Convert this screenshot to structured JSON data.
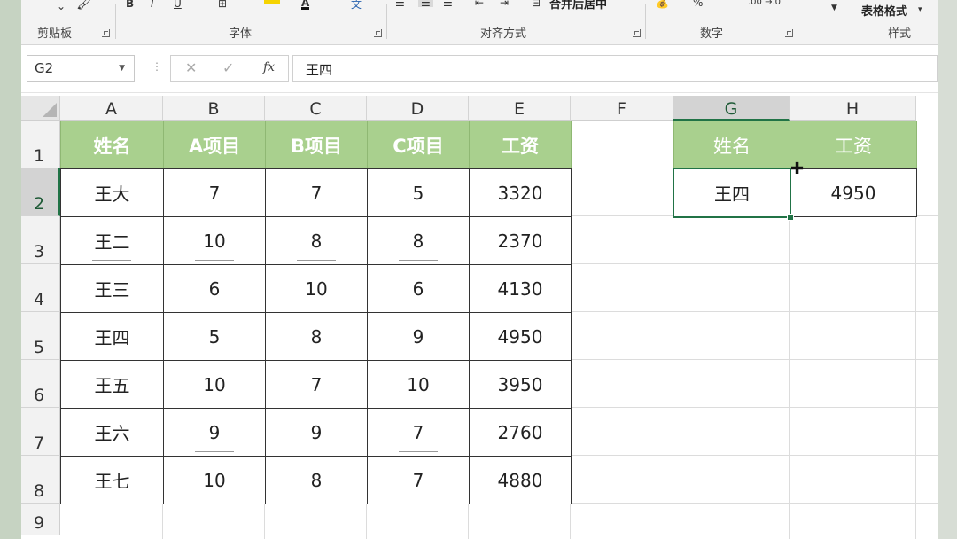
{
  "ribbon": {
    "groups": [
      {
        "label": "剪贴板"
      },
      {
        "label": "字体"
      },
      {
        "label": "对齐方式"
      },
      {
        "label": "数字"
      },
      {
        "label": "样式"
      }
    ],
    "merge_center_label": "合并后居中",
    "table_format_label": "表格格式",
    "bold_glyph": "B",
    "italic_glyph": "I",
    "underline_glyph": "U",
    "percent_glyph": "%"
  },
  "formula_bar": {
    "name_box": "G2",
    "cancel_glyph": "✕",
    "enter_glyph": "✓",
    "fx_glyph": "fx",
    "value": "王四"
  },
  "grid": {
    "columns": [
      "A",
      "B",
      "C",
      "D",
      "E",
      "F",
      "G",
      "H"
    ],
    "rows": [
      "1",
      "2",
      "3",
      "4",
      "5",
      "6",
      "7",
      "8",
      "9"
    ],
    "main_table": {
      "headers": [
        "姓名",
        "A项目",
        "B项目",
        "C项目",
        "工资"
      ],
      "rows": [
        [
          "王大",
          "7",
          "7",
          "5",
          "3320"
        ],
        [
          "王二",
          "10",
          "8",
          "8",
          "2370"
        ],
        [
          "王三",
          "6",
          "10",
          "6",
          "4130"
        ],
        [
          "王四",
          "5",
          "8",
          "9",
          "4950"
        ],
        [
          "王五",
          "10",
          "7",
          "10",
          "3950"
        ],
        [
          "王六",
          "9",
          "9",
          "7",
          "2760"
        ],
        [
          "王七",
          "10",
          "8",
          "7",
          "4880"
        ]
      ]
    },
    "lookup_table": {
      "headers": [
        "姓名",
        "工资"
      ],
      "values": [
        "王四",
        "4950"
      ]
    },
    "selected_cell": "G2"
  },
  "colors": {
    "header_fill": "#a9d08e",
    "selection": "#217346"
  }
}
